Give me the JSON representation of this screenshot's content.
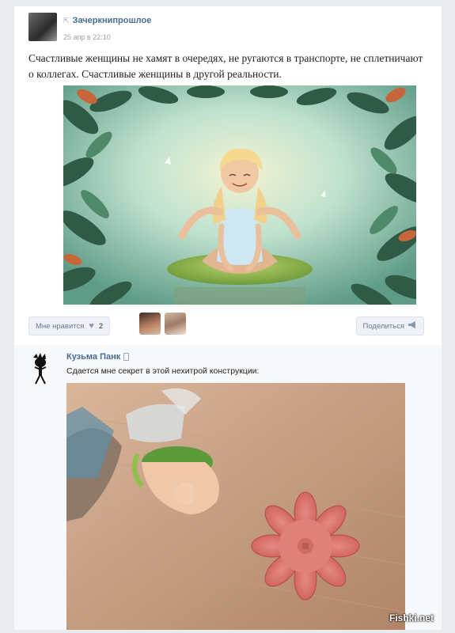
{
  "post": {
    "author": "Зачеркнипрошлое",
    "repost_icon": "repost-icon",
    "date": "25 апр в 22:10",
    "text": "Счастливые женщины не хамят в очередях, не ругаются в транспорте, не сплетничают о коллегах. Счастливые женщины в другой реальности.",
    "actions": {
      "like_label": "Мне нравится",
      "like_icon": "heart-icon",
      "like_count": "2",
      "share_label": "Поделиться",
      "share_icon": "megaphone-icon"
    }
  },
  "comment": {
    "author": "Кузьма Панк",
    "device_icon": "mobile-phone-icon",
    "text": "Сдается мне секрет в этой нехитрой конструкции:"
  },
  "watermark": "Fishki.net",
  "colors": {
    "link": "#4a6c91",
    "page_bg": "#e9ecef",
    "button_bg": "#eef1f5"
  }
}
